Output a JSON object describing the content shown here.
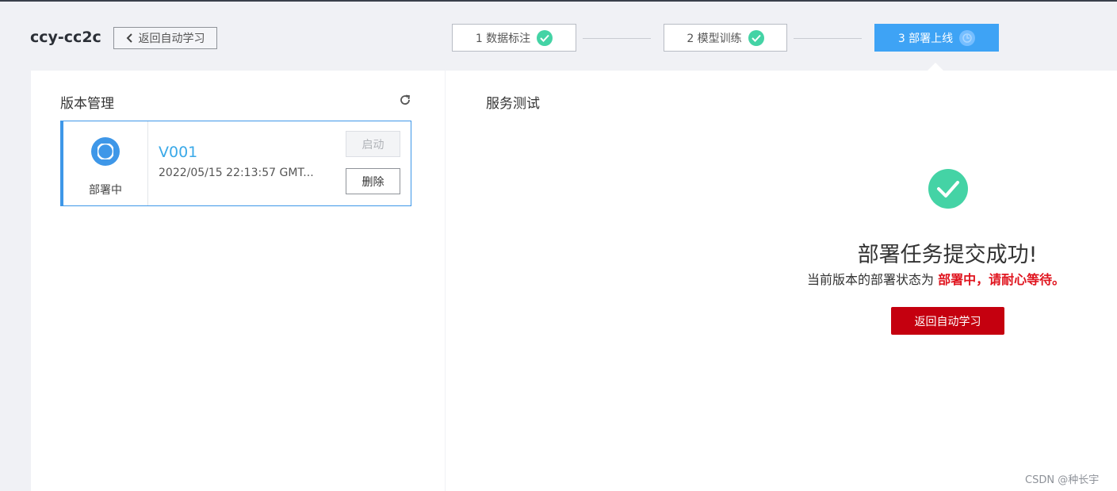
{
  "header": {
    "project_name": "ccy-cc2c",
    "back_button_label": "返回自动学习",
    "back_icon": "chevron-left-icon"
  },
  "steps": [
    {
      "label": "1 数据标注",
      "status": "done",
      "icon": "check-circle-icon"
    },
    {
      "label": "2 模型训练",
      "status": "done",
      "icon": "check-circle-icon"
    },
    {
      "label": "3 部署上线",
      "status": "active",
      "icon": "pending-circle-icon"
    }
  ],
  "version_panel": {
    "title": "版本管理",
    "refresh_icon": "refresh-icon",
    "versions": [
      {
        "status_label": "部署中",
        "status_icon": "deploying-icon",
        "name": "V001",
        "time": "2022/05/15 22:13:57 GMT...",
        "start_label": "启动",
        "start_enabled": false,
        "delete_label": "删除"
      }
    ]
  },
  "service_panel": {
    "title": "服务测试",
    "success_icon": "success-check-icon",
    "success_title": "部署任务提交成功!",
    "status_text_prefix": "当前版本的部署状态为",
    "status_text_highlight": "部署中，请耐心等待。",
    "return_button_label": "返回自动学习"
  },
  "watermark": "CSDN @种长宇",
  "colors": {
    "accent_blue": "#3ea3f5",
    "success_green": "#44d3a5",
    "version_blue": "#3aa9e8",
    "highlight_red": "#e0141e",
    "button_red": "#c5000f"
  }
}
